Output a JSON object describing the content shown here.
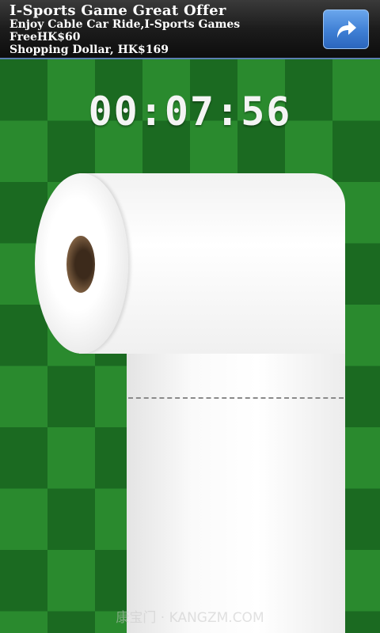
{
  "ad": {
    "title": "I-Sports Game Great Offer",
    "line1": "Enjoy Cable Car Ride,I-Sports Games FreeHK$60",
    "line2": "Shopping Dollar, HK$169",
    "action_icon": "share-arrow-icon"
  },
  "game": {
    "timer": "00:07:56"
  },
  "watermark": "康宝门 · KANGZM.COM",
  "colors": {
    "board_light": "#2a8a2e",
    "board_dark": "#1b6a21",
    "ad_button": "#3f7fd4"
  }
}
